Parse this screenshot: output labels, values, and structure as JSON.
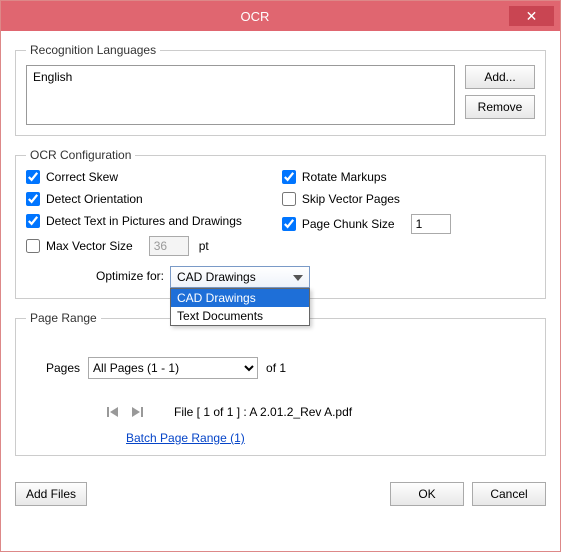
{
  "window": {
    "title": "OCR",
    "close": "✕"
  },
  "languages": {
    "legend": "Recognition Languages",
    "items": [
      "English"
    ],
    "add_label": "Add...",
    "remove_label": "Remove"
  },
  "config": {
    "legend": "OCR Configuration",
    "left": {
      "correct_skew": {
        "label": "Correct Skew",
        "checked": true
      },
      "detect_orientation": {
        "label": "Detect Orientation",
        "checked": true
      },
      "detect_text_pics": {
        "label": "Detect Text in Pictures and Drawings",
        "checked": true
      },
      "max_vector": {
        "label": "Max Vector Size",
        "checked": false,
        "value": "36",
        "unit": "pt"
      }
    },
    "right": {
      "rotate_markups": {
        "label": "Rotate Markups",
        "checked": true
      },
      "skip_vector": {
        "label": "Skip Vector Pages",
        "checked": false
      },
      "page_chunk": {
        "label": "Page Chunk Size",
        "checked": true,
        "value": "1"
      }
    },
    "optimize": {
      "label": "Optimize for:",
      "selected": "CAD Drawings",
      "options": [
        "CAD Drawings",
        "Text Documents"
      ]
    }
  },
  "page_range": {
    "legend": "Page Range",
    "pages_label": "Pages",
    "pages_selected": "All Pages (1 - 1)",
    "of_total": "of 1",
    "file_info": "File [ 1 of 1 ] :  A 2.01.2_Rev A.pdf",
    "batch_link": "Batch Page Range (1)"
  },
  "footer": {
    "add_files": "Add Files",
    "ok": "OK",
    "cancel": "Cancel"
  }
}
